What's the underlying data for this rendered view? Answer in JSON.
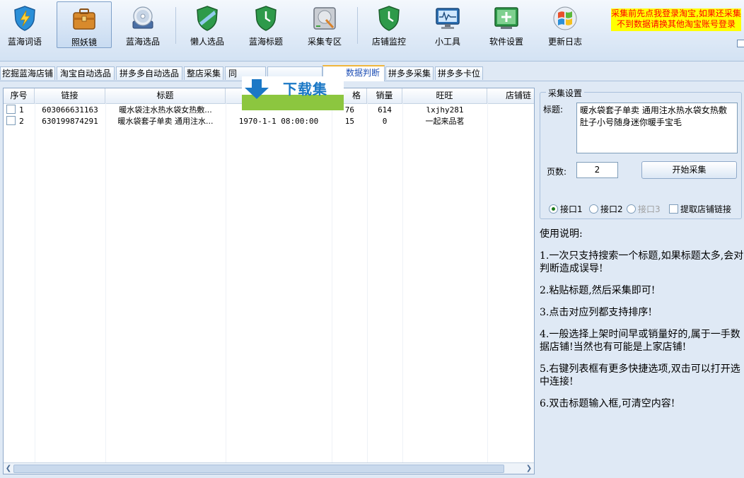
{
  "toolbar": {
    "buttons": [
      {
        "label": "蓝海词语",
        "icon": "lightning-shield-icon"
      },
      {
        "label": "照妖镜",
        "icon": "briefcase-icon"
      },
      {
        "label": "蓝海选品",
        "icon": "disc-icon"
      },
      {
        "label": "懒人选品",
        "icon": "shield-icon"
      },
      {
        "label": "蓝海标题",
        "icon": "clock-shield-icon"
      },
      {
        "label": "采集专区",
        "icon": "harddisk-icon"
      },
      {
        "label": "店铺监控",
        "icon": "clock-shield-icon"
      },
      {
        "label": "小工具",
        "icon": "monitor-icon"
      },
      {
        "label": "软件设置",
        "icon": "settings-screen-icon"
      },
      {
        "label": "更新日志",
        "icon": "windows-logo-icon"
      }
    ],
    "active_index": 1,
    "notice": "采集前先点我登录淘宝,如果还采集不到数据请换其他淘宝账号登录"
  },
  "tabs": [
    {
      "label": "挖掘蓝海店铺"
    },
    {
      "label": "淘宝自动选品"
    },
    {
      "label": "拼多多自动选品"
    },
    {
      "label": "整店采集"
    },
    {
      "label": "同"
    },
    {
      "label": ""
    },
    {
      "label": "数据判断"
    },
    {
      "label": "拼多多采集"
    },
    {
      "label": "拼多多卡位"
    }
  ],
  "watermark": {
    "text": "下载集"
  },
  "table": {
    "headers": [
      "序号",
      "链接",
      "标题",
      "",
      "格",
      "销量",
      "旺旺",
      "店铺链"
    ],
    "rows": [
      {
        "index": "1",
        "link": "603066631163",
        "title": "暖水袋注水热水袋女热敷...",
        "time": "",
        "price": "76",
        "sales": "614",
        "wangwang": "lxjhy281"
      },
      {
        "index": "2",
        "link": "630199874291",
        "title": "暖水袋套子单卖 通用注水...",
        "time": "1970-1-1 08:00:00",
        "price": "15",
        "sales": "0",
        "wangwang": "一起来品茗"
      }
    ]
  },
  "settings": {
    "group_title": "采集设置",
    "title_label": "标题:",
    "title_value": "暖水袋套子单卖 通用注水热水袋女热敷肚子小号随身迷你暖手宝毛",
    "pages_label": "页数:",
    "pages_value": "2",
    "start_button": "开始采集",
    "interfaces": [
      {
        "label": "接口1",
        "selected": true,
        "disabled": false
      },
      {
        "label": "接口2",
        "selected": false,
        "disabled": false
      },
      {
        "label": "接口3",
        "selected": false,
        "disabled": true
      }
    ],
    "fetch_shop_link_label": "提取店铺链接"
  },
  "instructions": [
    "使用说明:",
    "1.一次只支持搜索一个标题,如果标题太多,会对判断造成误导!",
    "2.粘贴标题,然后采集即可!",
    "3.点击对应列都支持排序!",
    "4.一般选择上架时间早或销量好的,属于一手数据店铺!当然也有可能是上家店铺!",
    "5.右键列表框有更多快捷选项,双击可以打开选中连接!",
    "6.双击标题输入框,可清空内容!"
  ]
}
